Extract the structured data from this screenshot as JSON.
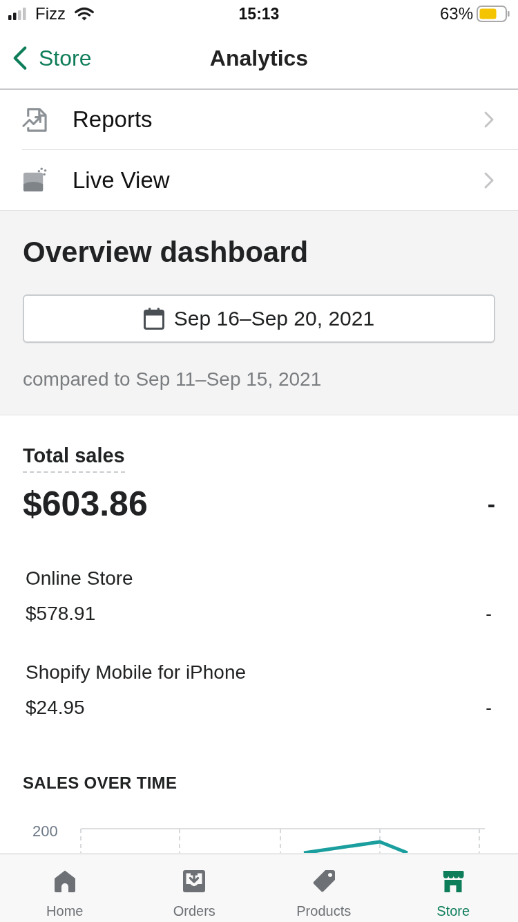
{
  "status_bar": {
    "carrier": "Fizz",
    "time": "15:13",
    "battery": "63%"
  },
  "nav": {
    "back": "Store",
    "title": "Analytics"
  },
  "menu": [
    {
      "label": "Reports"
    },
    {
      "label": "Live View"
    }
  ],
  "overview": {
    "title": "Overview dashboard",
    "date_range": "Sep 16–Sep 20, 2021",
    "comparison": "compared to Sep 11–Sep 15, 2021"
  },
  "total_sales": {
    "label": "Total sales",
    "value": "$603.86",
    "change": "-"
  },
  "channels": [
    {
      "name": "Online Store",
      "value": "$578.91",
      "change": "-"
    },
    {
      "name": "Shopify Mobile for iPhone",
      "value": "$24.95",
      "change": "-"
    }
  ],
  "sales_over_time": {
    "title": "SALES OVER TIME",
    "y_tick": "200"
  },
  "tab_bar": [
    {
      "label": "Home",
      "selected": false
    },
    {
      "label": "Orders",
      "selected": false
    },
    {
      "label": "Products",
      "selected": false
    },
    {
      "label": "Store",
      "selected": true
    }
  ]
}
